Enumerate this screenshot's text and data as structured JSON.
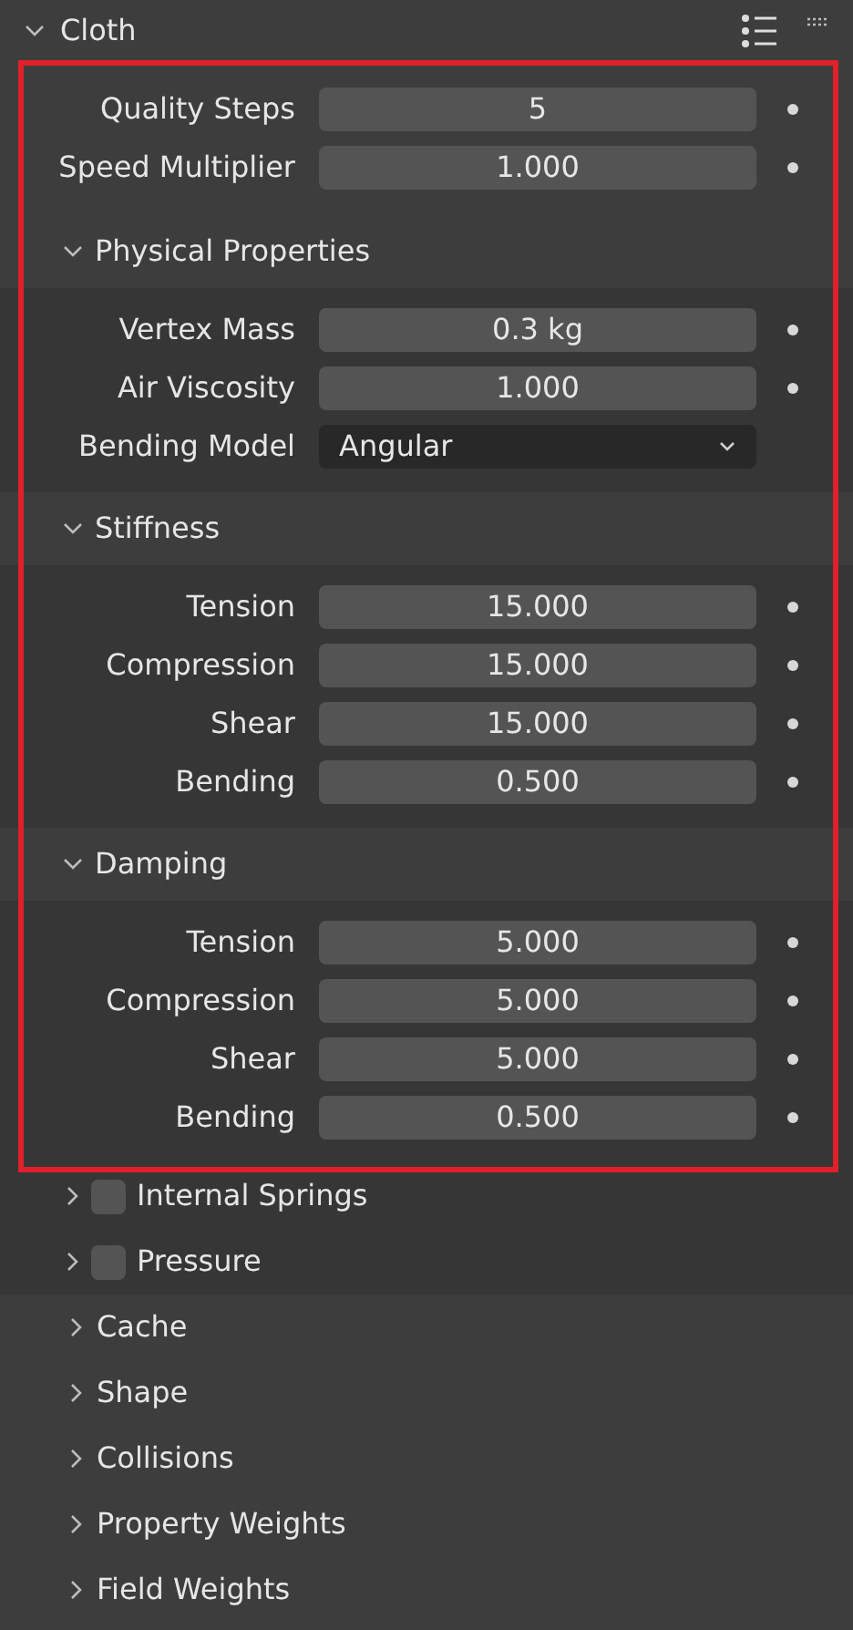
{
  "panel": {
    "title": "Cloth",
    "expanded": true
  },
  "fields": [
    {
      "label": "Quality Steps",
      "value": "5",
      "kind": "number"
    },
    {
      "label": "Speed Multiplier",
      "value": "1.000",
      "kind": "number"
    }
  ],
  "subpanels": [
    {
      "title": "Physical Properties",
      "expanded": true,
      "fields": [
        {
          "label": "Vertex Mass",
          "value": "0.3 kg",
          "kind": "number"
        },
        {
          "label": "Air Viscosity",
          "value": "1.000",
          "kind": "number"
        },
        {
          "label": "Bending Model",
          "value": "Angular",
          "kind": "dropdown"
        }
      ]
    },
    {
      "title": "Stiffness",
      "expanded": true,
      "fields": [
        {
          "label": "Tension",
          "value": "15.000",
          "kind": "number"
        },
        {
          "label": "Compression",
          "value": "15.000",
          "kind": "number"
        },
        {
          "label": "Shear",
          "value": "15.000",
          "kind": "number"
        },
        {
          "label": "Bending",
          "value": "0.500",
          "kind": "number"
        }
      ]
    },
    {
      "title": "Damping",
      "expanded": true,
      "fields": [
        {
          "label": "Tension",
          "value": "5.000",
          "kind": "number"
        },
        {
          "label": "Compression",
          "value": "5.000",
          "kind": "number"
        },
        {
          "label": "Shear",
          "value": "5.000",
          "kind": "number"
        },
        {
          "label": "Bending",
          "value": "0.500",
          "kind": "number"
        }
      ]
    },
    {
      "title": "Internal Springs",
      "expanded": false,
      "checked": false
    },
    {
      "title": "Pressure",
      "expanded": false,
      "checked": false
    }
  ],
  "panels": [
    {
      "title": "Cache",
      "expanded": false
    },
    {
      "title": "Shape",
      "expanded": false
    },
    {
      "title": "Collisions",
      "expanded": false
    },
    {
      "title": "Property Weights",
      "expanded": false
    },
    {
      "title": "Field Weights",
      "expanded": false
    }
  ]
}
